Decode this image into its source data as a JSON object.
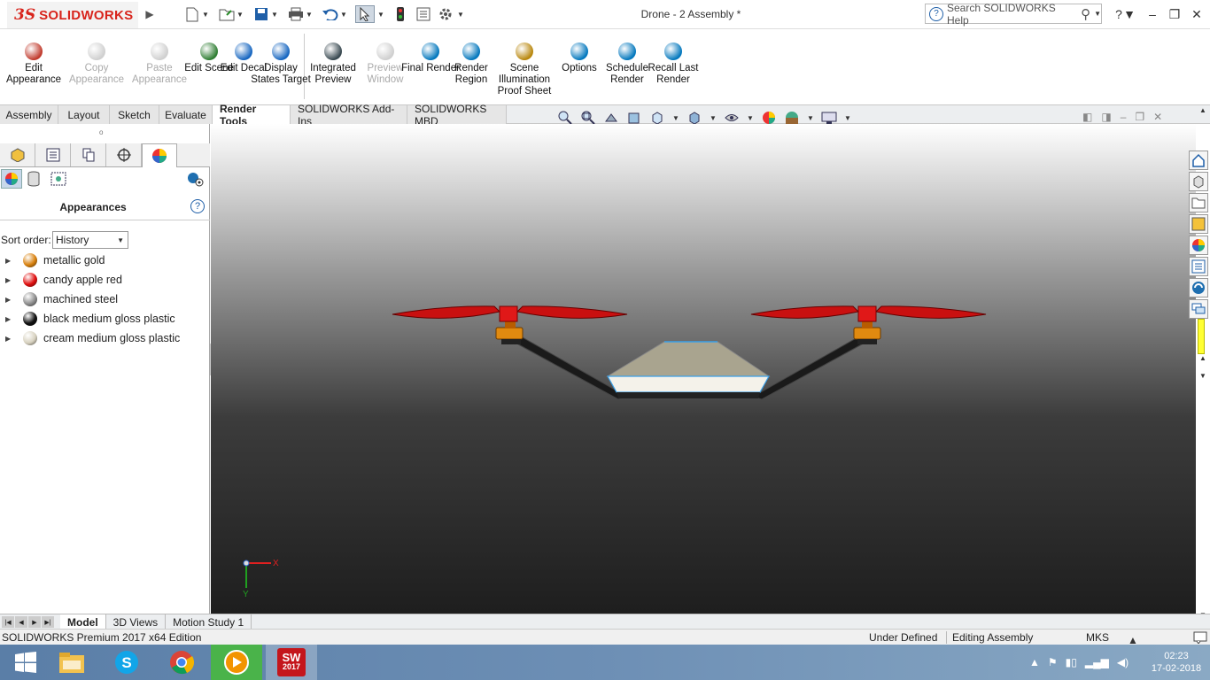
{
  "app": {
    "brand_ds": "3S",
    "brand_name": "SOLIDWORKS",
    "document_title": "Drone - 2 Assembly *",
    "search_placeholder": "Search SOLIDWORKS Help",
    "help": "?"
  },
  "ribbon": [
    {
      "label": "Edit Appearance",
      "enabled": true,
      "icon": "edit-appearance-icon",
      "color": "#c0392b"
    },
    {
      "label": "Copy Appearance",
      "enabled": false,
      "icon": "copy-appearance-icon",
      "color": "#777"
    },
    {
      "label": "Paste Appearance",
      "enabled": false,
      "icon": "paste-appearance-icon",
      "color": "#777"
    },
    {
      "label": "Edit Scene",
      "enabled": true,
      "icon": "edit-scene-icon",
      "color": "#2e7d32"
    },
    {
      "label": "Edit Decal",
      "enabled": true,
      "icon": "edit-decal-icon",
      "color": "#1565c0"
    },
    {
      "label": "Display States Target",
      "enabled": true,
      "icon": "display-states-icon",
      "color": "#1565c0"
    },
    {
      "label": "Integrated Preview",
      "enabled": true,
      "icon": "integrated-preview-icon",
      "color": "#37474f"
    },
    {
      "label": "Preview Window",
      "enabled": false,
      "icon": "preview-window-icon",
      "color": "#777"
    },
    {
      "label": "Final Render",
      "enabled": true,
      "icon": "final-render-icon",
      "color": "#0277bd"
    },
    {
      "label": "Render Region",
      "enabled": true,
      "icon": "render-region-icon",
      "color": "#0277bd"
    },
    {
      "label": "Scene Illumination Proof Sheet",
      "enabled": true,
      "icon": "proof-sheet-icon",
      "color": "#b8860b"
    },
    {
      "label": "Options",
      "enabled": true,
      "icon": "options-icon",
      "color": "#0277bd"
    },
    {
      "label": "Schedule Render",
      "enabled": true,
      "icon": "schedule-render-icon",
      "color": "#0277bd"
    },
    {
      "label": "Recall Last Render",
      "enabled": true,
      "icon": "recall-render-icon",
      "color": "#0277bd"
    }
  ],
  "tabs": [
    "Assembly",
    "Layout",
    "Sketch",
    "Evaluate",
    "Render Tools",
    "SOLIDWORKS Add-Ins",
    "SOLIDWORKS MBD"
  ],
  "active_tab": "Render Tools",
  "panel": {
    "title": "Appearances",
    "sort_label": "Sort order:",
    "sort_value": "History",
    "materials": [
      {
        "name": "metallic gold",
        "color": "#d9820f"
      },
      {
        "name": "candy apple red",
        "color": "#e01010"
      },
      {
        "name": "machined steel",
        "color": "#8e8e8e"
      },
      {
        "name": "black medium gloss plastic",
        "color": "#111111"
      },
      {
        "name": "cream medium gloss plastic",
        "color": "#d8d2c0"
      }
    ]
  },
  "triad": {
    "x": "X",
    "y": "Y"
  },
  "bottom_tabs": [
    "Model",
    "3D Views",
    "Motion Study 1"
  ],
  "status": {
    "edition": "SOLIDWORKS Premium 2017 x64 Edition",
    "state": "Under Defined",
    "mode": "Editing Assembly",
    "units": "MKS"
  },
  "taskbar": {
    "time": "02:23",
    "date": "17-02-2018",
    "sw_label": "2017"
  }
}
